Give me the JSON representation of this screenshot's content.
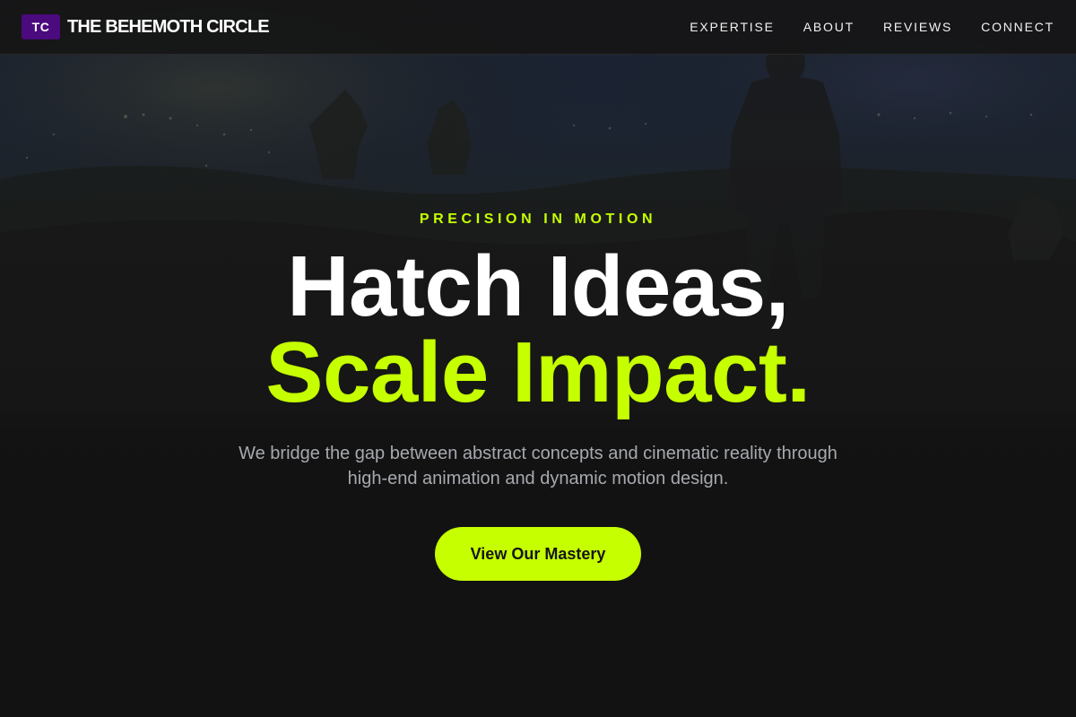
{
  "theme": {
    "accent": "#c6ff00",
    "brand_mark_bg": "#4b0a7e",
    "background": "#121212"
  },
  "header": {
    "logo_mark": "TC",
    "brand_name": "THE BEHEMOTH CIRCLE",
    "nav": [
      {
        "label": "EXPERTISE"
      },
      {
        "label": "ABOUT"
      },
      {
        "label": "REVIEWS"
      },
      {
        "label": "CONNECT"
      }
    ]
  },
  "hero": {
    "eyebrow": "PRECISION IN MOTION",
    "headline_line1": "Hatch Ideas,",
    "headline_line2": "Scale Impact.",
    "subtitle": "We bridge the gap between abstract concepts and cinematic reality through high-end animation and dynamic motion design.",
    "cta_label": "View Our Mastery"
  },
  "background_image": {
    "icon": "night-landscape-with-figure"
  }
}
